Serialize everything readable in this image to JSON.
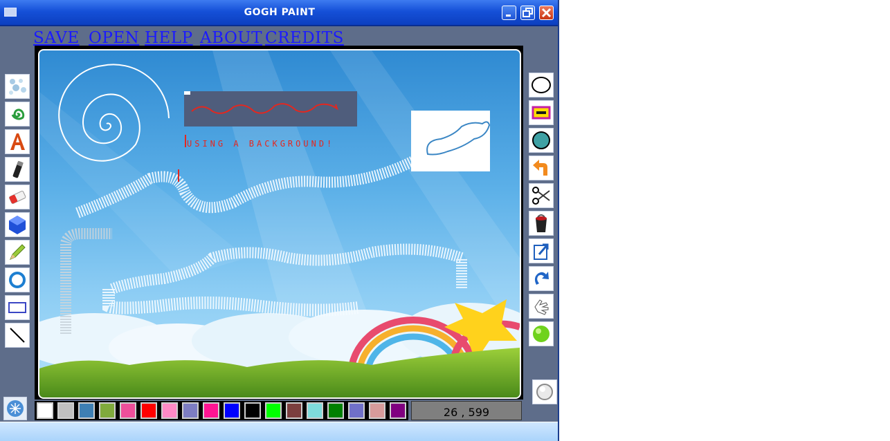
{
  "window": {
    "title": "GOGH PAINT"
  },
  "menu": [
    {
      "label": "SAVE"
    },
    {
      "label": "OPEN"
    },
    {
      "label": "HELP"
    },
    {
      "label": "ABOUT"
    },
    {
      "label": "CREDITS"
    }
  ],
  "canvas": {
    "text": "USING A BACKGROUND!"
  },
  "left_tools": [
    {
      "icon": "spray-icon"
    },
    {
      "icon": "spiral-icon"
    },
    {
      "icon": "text-icon"
    },
    {
      "icon": "marker-icon"
    },
    {
      "icon": "eraser-icon"
    },
    {
      "icon": "fill-shape-icon"
    },
    {
      "icon": "pencil-icon"
    },
    {
      "icon": "ring-icon"
    },
    {
      "icon": "rectangle-icon"
    },
    {
      "icon": "line-icon"
    }
  ],
  "right_tools": [
    {
      "icon": "ellipse-icon"
    },
    {
      "icon": "filled-rectangle-icon"
    },
    {
      "icon": "filled-circle-icon"
    },
    {
      "icon": "undo-icon"
    },
    {
      "icon": "scissors-icon"
    },
    {
      "icon": "bucket-icon"
    },
    {
      "icon": "export-icon"
    },
    {
      "icon": "redo-icon"
    },
    {
      "icon": "hand-icon"
    },
    {
      "icon": "green-ball-icon"
    }
  ],
  "palette": [
    "#ffffff",
    "#c0c0c0",
    "#3e7fb3",
    "#80aa3c",
    "#ee4f9a",
    "#ff0000",
    "#ff8ac6",
    "#7d7dc2",
    "#ff1493",
    "#0000ff",
    "#000000",
    "#00ff00",
    "#7b3f3f",
    "#7fdcdc",
    "#008000",
    "#7070c8",
    "#d79b9b",
    "#800080"
  ],
  "status": {
    "coords": "26 , 599"
  }
}
